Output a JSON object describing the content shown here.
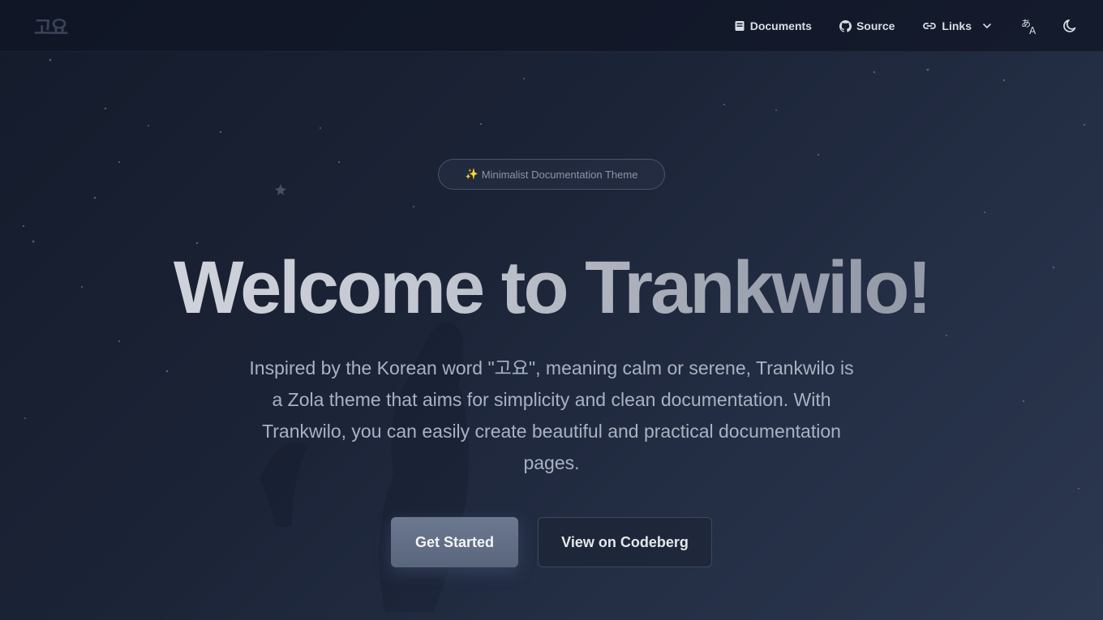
{
  "header": {
    "logo_text": "고요",
    "nav": [
      {
        "label": "Documents",
        "icon": "book-icon"
      },
      {
        "label": "Source",
        "icon": "github-icon"
      },
      {
        "label": "Links",
        "icon": "link-icon"
      }
    ],
    "language_icon": "translate-icon",
    "theme_icon": "moon-icon"
  },
  "hero": {
    "badge_emoji": "✨",
    "badge_text": "Minimalist Documentation Theme",
    "title": "Welcome to Trankwilo!",
    "description": "Inspired by the Korean word \"고요\", meaning calm or serene, Trankwilo is a Zola theme that aims for simplicity and clean documentation. With Trankwilo, you can easily create beautiful and practical documentation pages.",
    "primary_button": "Get Started",
    "secondary_button": "View on Codeberg"
  },
  "colors": {
    "background": "#1b2336",
    "primary_button": "#5f6b82",
    "text_muted": "#a9b2c2"
  }
}
